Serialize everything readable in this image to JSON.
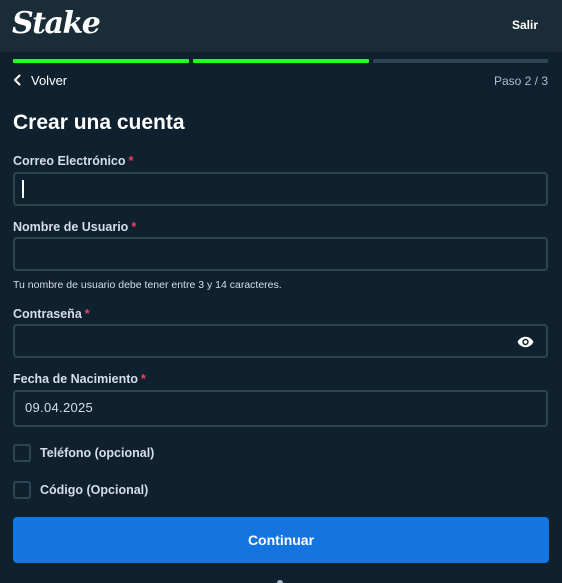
{
  "header": {
    "logo": "Stake",
    "exit_label": "Salir"
  },
  "progress": {
    "steps_total": 3,
    "steps_done": 2,
    "done_color": "#1fff20",
    "pending_color": "#2f4553"
  },
  "nav": {
    "back_label": "Volver",
    "step_label": "Paso 2 / 3"
  },
  "form": {
    "title": "Crear una cuenta",
    "email": {
      "label": "Correo Electrónico",
      "required_mark": "*",
      "value": ""
    },
    "username": {
      "label": "Nombre de Usuario",
      "required_mark": "*",
      "value": "",
      "hint": "Tu nombre de usuario debe tener entre 3 y 14 caracteres."
    },
    "password": {
      "label": "Contraseña",
      "required_mark": "*",
      "value": "",
      "toggle_icon": "eye-icon"
    },
    "birthdate": {
      "label": "Fecha de Nacimiento",
      "required_mark": "*",
      "value": "09.04.2025"
    },
    "phone_option": {
      "label": "Teléfono (opcional)",
      "checked": false
    },
    "code_option": {
      "label": "Código (Opcional)",
      "checked": false
    },
    "submit_label": "Continuar"
  },
  "colors": {
    "background": "#0f212e",
    "header": "#1a2c38",
    "border": "#2f4553",
    "accent_button": "#1475e1",
    "required": "#ed4163"
  }
}
